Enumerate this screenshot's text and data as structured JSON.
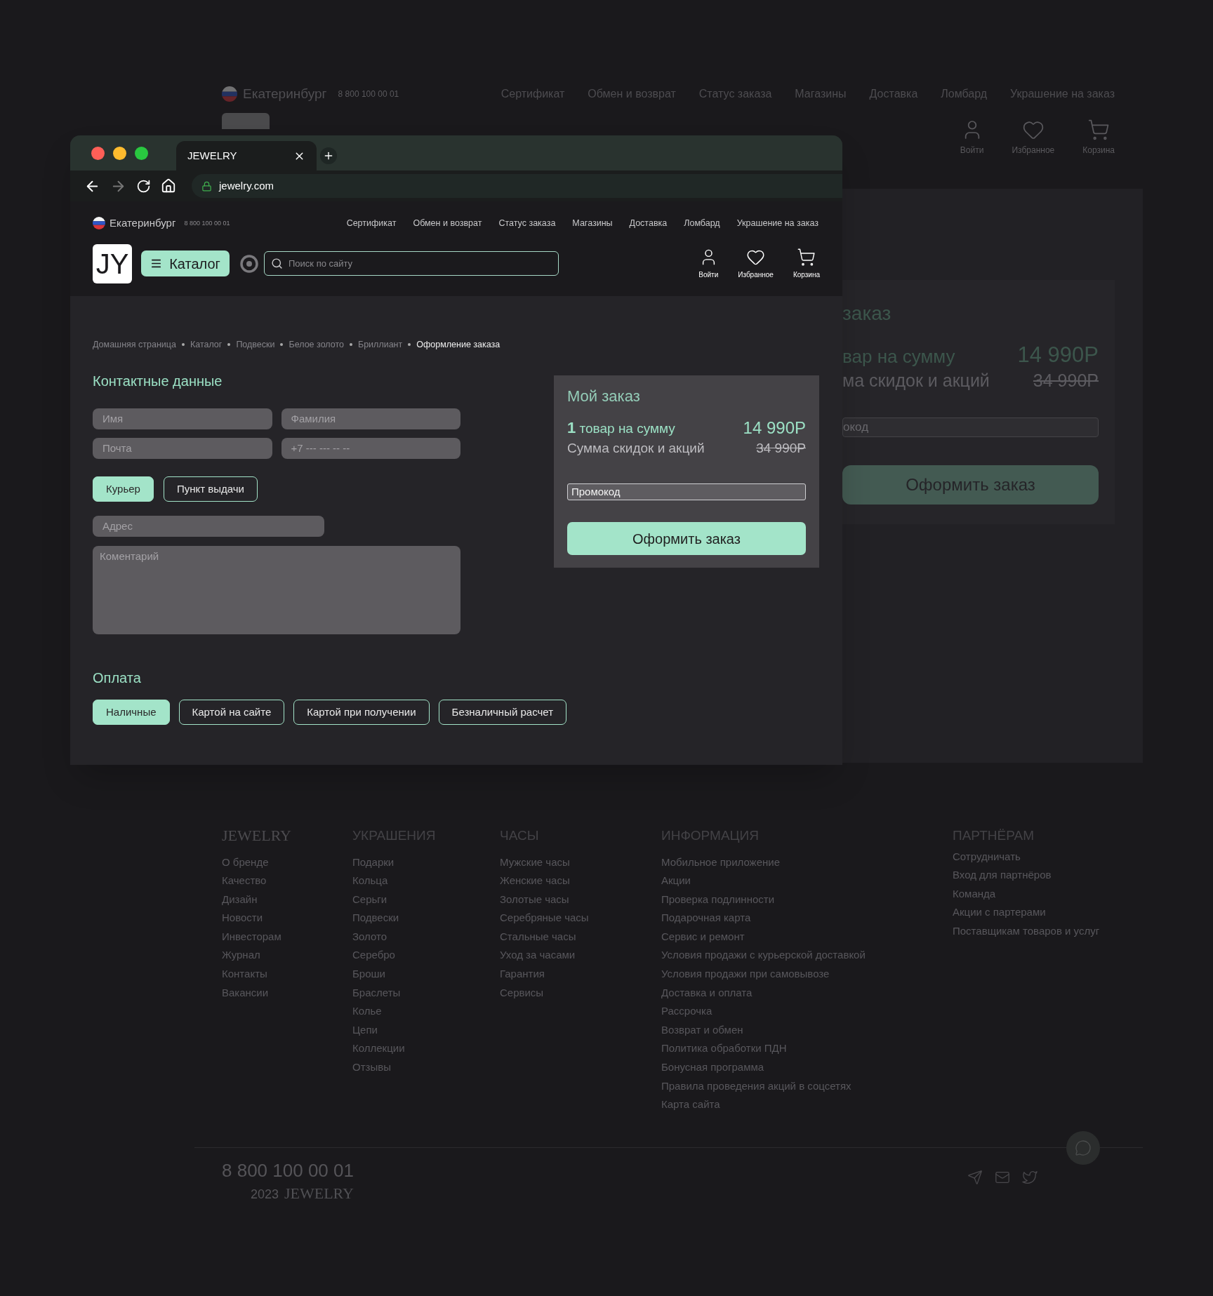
{
  "background_page": {
    "header": {
      "city": "Екатеринбург",
      "phone": "8 800 100 00 01",
      "nav": [
        "Сертификат",
        "Обмен и возврат",
        "Статус заказа",
        "Магазины",
        "Доставка",
        "Ломбард",
        "Украшение на заказ"
      ],
      "actions": [
        {
          "kind": "user",
          "label": "Войти"
        },
        {
          "kind": "heart",
          "label": "Избранное"
        },
        {
          "kind": "cart",
          "label": "Корзина"
        }
      ]
    },
    "order_card": {
      "title": "заказ",
      "items_text": "вар на сумму",
      "total": "14 990Р",
      "discount_text": "ма скидок и акций",
      "old_price": "34 990Р",
      "promo_placeholder": "окод",
      "submit": "Оформить заказ"
    },
    "footer": {
      "columns": [
        {
          "kind": "brand",
          "title": "JEWELRY",
          "links": [
            "О бренде",
            "Качество",
            "Дизайн",
            "Новости",
            "Инвесторам",
            "Журнал",
            "Контакты",
            "Вакансии"
          ]
        },
        {
          "kind": "section",
          "title": "УКРАШЕНИЯ",
          "links": [
            "Подарки",
            "Кольца",
            "Серьги",
            "Подвески",
            "Золото",
            "Серебро",
            "Броши",
            "Браслеты",
            "Колье",
            "Цепи",
            "Коллекции",
            "Отзывы"
          ]
        },
        {
          "kind": "section",
          "title": "ЧАСЫ",
          "links": [
            "Мужские часы",
            "Женские часы",
            "Золотые часы",
            "Серебряные часы",
            "Стальные часы",
            "Уход за часами",
            "Гарантия",
            "Сервисы"
          ]
        },
        {
          "kind": "section",
          "title": "ИНФОРМАЦИЯ",
          "links": [
            "Мобильное приложение",
            "Акции",
            "Проверка подлинности",
            "Подарочная карта",
            "Сервис и ремонт",
            "Условия продажи с курьерской доставкой",
            "Условия продажи при самовывозе",
            "Доставка и оплата",
            "Рассрочка",
            "Возврат и обмен",
            "Политика обработки ПДН",
            "Бонусная программа",
            "Правила проведения акций в соцсетях",
            "Карта сайта"
          ]
        },
        {
          "kind": "compact",
          "title": "ПАРТНЁРАМ",
          "links": [
            "Сотрудничать",
            "Вход для партнёров",
            "Команда",
            "Акции с партерами",
            "Поставщикам товаров и услуг"
          ]
        }
      ],
      "phone": "8 800 100 00 01",
      "year": "2023",
      "brand": "JEWELRY"
    }
  },
  "browser": {
    "tab_title": "JEWELRY",
    "url": "jewelry.com",
    "page": {
      "header": {
        "city": "Екатеринбург",
        "phone": "8 800 100 00 01",
        "nav": [
          "Сертификат",
          "Обмен и возврат",
          "Статус заказа",
          "Магазины",
          "Доставка",
          "Ломбард",
          "Украшение на заказ"
        ],
        "logo": "JY",
        "catalog": "Каталог",
        "search_placeholder": "Поиск по сайту",
        "actions": [
          {
            "kind": "user",
            "label": "Войти"
          },
          {
            "kind": "heart",
            "label": "Избранное"
          },
          {
            "kind": "cart",
            "label": "Корзина"
          }
        ]
      },
      "breadcrumbs": [
        {
          "label": "Домашняя страница",
          "current": false
        },
        {
          "label": "Каталог",
          "current": false
        },
        {
          "label": "Подвески",
          "current": false
        },
        {
          "label": "Белое золото",
          "current": false
        },
        {
          "label": "Бриллиант",
          "current": false
        },
        {
          "label": "Оформление заказа",
          "current": true
        }
      ],
      "contact": {
        "title": "Контактные данные",
        "fields": [
          {
            "placeholder": "Имя"
          },
          {
            "placeholder": "Фамилия"
          },
          {
            "placeholder": "Почта"
          },
          {
            "placeholder": "+7 --- --- -- --"
          }
        ],
        "delivery": [
          {
            "label": "Курьер",
            "selected": true
          },
          {
            "label": "Пункт выдачи",
            "selected": false
          }
        ],
        "address_placeholder": "Адрес",
        "comment_placeholder": "Коментарий"
      },
      "payment": {
        "title": "Оплата",
        "options": [
          {
            "label": "Наличные",
            "selected": true
          },
          {
            "label": "Картой на сайте",
            "selected": false
          },
          {
            "label": "Картой при получении",
            "selected": false
          },
          {
            "label": "Безналичный расчет",
            "selected": false
          }
        ]
      },
      "order": {
        "title": "Мой заказ",
        "count": "1",
        "items_text": "товар на сумму",
        "total": "14 990Р",
        "discount_text": "Сумма скидок и акций",
        "old_price": "34 990Р",
        "promo_placeholder": "Промокод",
        "submit": "Оформить заказ"
      }
    }
  }
}
